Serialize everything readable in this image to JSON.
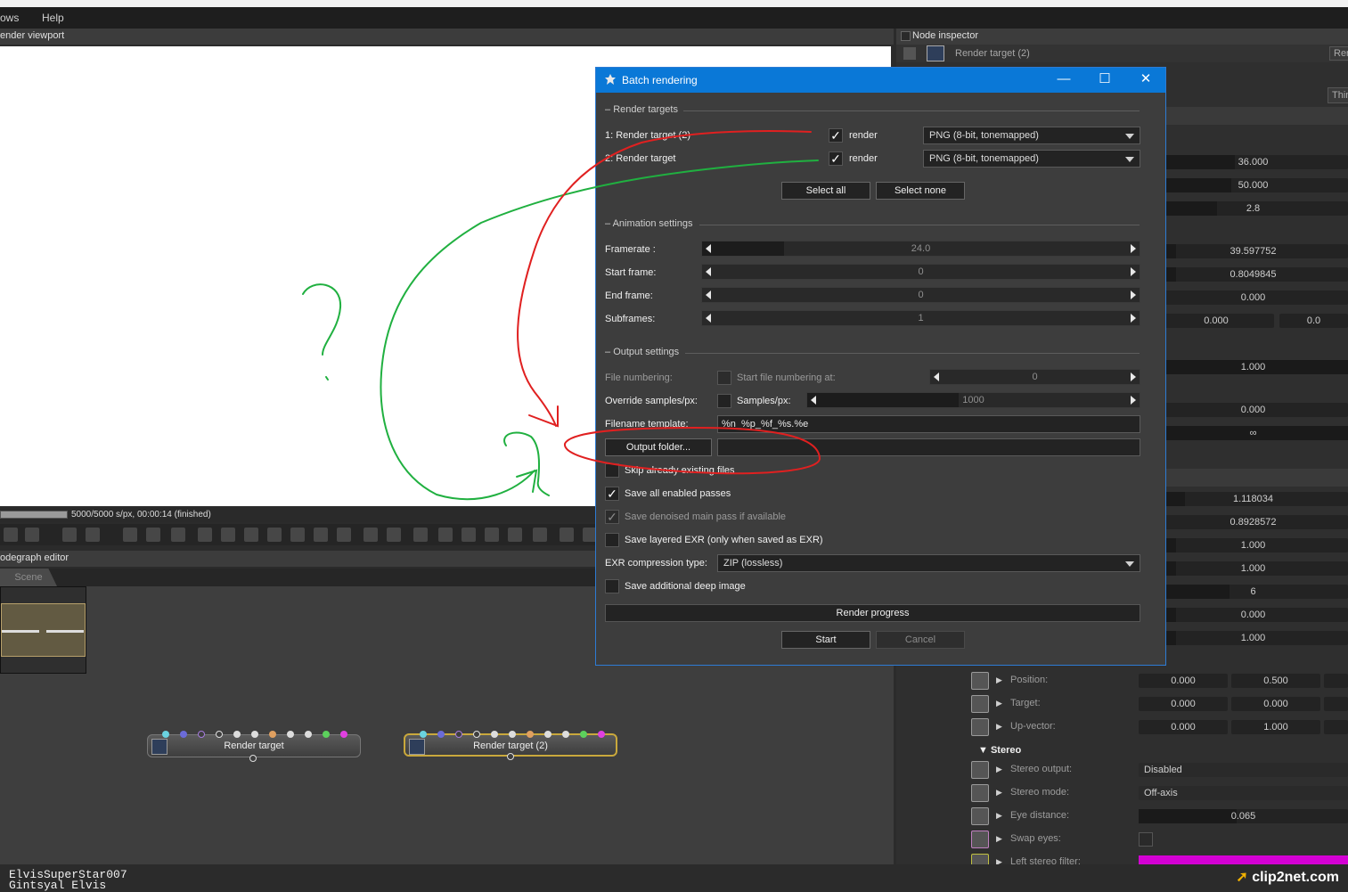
{
  "menu": {
    "windows": "ows",
    "help": "Help"
  },
  "viewport": {
    "title": "ender viewport",
    "status": "5000/5000 s/px, 00:00:14 (finished)",
    "progress": 1.0
  },
  "nodegraph": {
    "title": "odegraph editor",
    "tab": "Scene",
    "nodes": [
      {
        "label": "Render target"
      },
      {
        "label": "Render target (2)"
      }
    ]
  },
  "inspector": {
    "title": "Node inspector",
    "node": "Render target (2)",
    "right_button": "Ren",
    "thin_button": "Thin",
    "values": [
      "36.000",
      "50.000",
      "2.8",
      "39.597752",
      "0.8049845",
      "0.000",
      "0.000",
      "0.0",
      "1.000",
      "0.000",
      "∞",
      "1.118034",
      "0.8928572",
      "1.000",
      "1.000",
      "6",
      "0.000",
      "1.000"
    ],
    "rows": [
      {
        "label": "Position:",
        "v1": "0.000",
        "v2": "0.500"
      },
      {
        "label": "Target:",
        "v1": "0.000",
        "v2": "0.000"
      },
      {
        "label": "Up-vector:",
        "v1": "0.000",
        "v2": "1.000"
      }
    ],
    "stereo_header": "Stereo",
    "stereo_rows": [
      {
        "label": "Stereo output:",
        "value": "Disabled"
      },
      {
        "label": "Stereo mode:",
        "value": "Off-axis"
      },
      {
        "label": "Eye distance:",
        "value": "0.065"
      },
      {
        "label": "Swap eyes:",
        "value": ""
      },
      {
        "label": "Left stereo filter:",
        "value": ""
      }
    ],
    "filter_color": "#d400d4"
  },
  "dialog": {
    "title": "Batch rendering",
    "render_targets_section": "Render targets",
    "targets": [
      {
        "name": "1: Render target (2)",
        "render_label": "render",
        "checked": true,
        "format": "PNG (8-bit, tonemapped)"
      },
      {
        "name": "2: Render target",
        "render_label": "render",
        "checked": true,
        "format": "PNG (8-bit, tonemapped)"
      }
    ],
    "select_all": "Select all",
    "select_none": "Select none",
    "animation_section": "Animation settings",
    "framerate_label": "Framerate :",
    "framerate": "24.0",
    "start_frame_label": "Start frame:",
    "start_frame": "0",
    "end_frame_label": "End frame:",
    "end_frame": "0",
    "subframes_label": "Subframes:",
    "subframes": "1",
    "output_section": "Output settings",
    "file_numbering_label": "File numbering:",
    "start_numbering_label": "Start file numbering at:",
    "start_numbering": "0",
    "override_label": "Override samples/px:",
    "samples_label": "Samples/px:",
    "samples": "1000",
    "filename_label": "Filename template:",
    "filename_value": "%n_%p_%f_%s.%e",
    "output_folder_button": "Output folder...",
    "output_folder_value": "",
    "skip_label": "Skip already existing files",
    "save_passes_label": "Save all enabled passes",
    "save_denoised_label": "Save denoised main pass if available",
    "save_layered_label": "Save layered EXR (only when saved as EXR)",
    "exr_label": "EXR compression type:",
    "exr_value": "ZIP (lossless)",
    "deep_label": "Save additional deep image",
    "progress_label": "Render progress",
    "start": "Start",
    "cancel": "Cancel"
  },
  "annotation": {
    "question_mark": "?"
  },
  "footer": {
    "user_line1": "ElvisSuperStar007",
    "user_line2": "Gintsyal Elvis",
    "logo": "clip2net.com"
  }
}
